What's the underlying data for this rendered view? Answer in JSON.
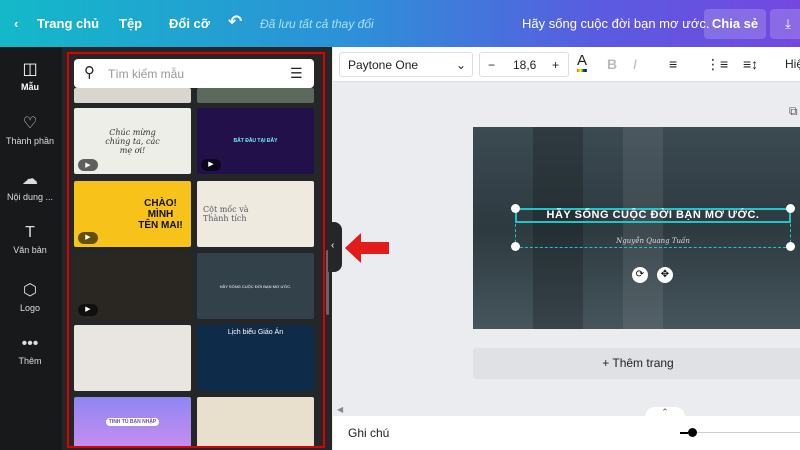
{
  "topbar": {
    "back": "Trang chủ",
    "file": "Tệp",
    "resize": "Đổi cỡ",
    "undo_icon": "undo-icon",
    "saved": "Đã lưu tất cả thay đổi",
    "doc_title": "Hãy sống cuộc đời bạn mơ ước.",
    "share": "Chia sẻ",
    "download_icon": "download-icon"
  },
  "rail": [
    {
      "label": "Mẫu",
      "icon": "layout-icon"
    },
    {
      "label": "Thành phần",
      "icon": "elements-icon"
    },
    {
      "label": "Nội dung ...",
      "icon": "upload-icon"
    },
    {
      "label": "Văn bản",
      "icon": "text-icon"
    },
    {
      "label": "Logo",
      "icon": "logo-icon"
    },
    {
      "label": "Thêm",
      "icon": "more-icon"
    }
  ],
  "panel": {
    "search_placeholder": "Tìm kiếm mẫu",
    "templates": [
      {
        "text": "Chúc mừng chúng ta, các mẹ ơi!"
      },
      {
        "text": "BẮT ĐẦU TẠI ĐÂY"
      },
      {
        "text": "CHÀO! MÌNH TÊN MAI!"
      },
      {
        "text": "Cột mốc và Thành tích"
      },
      {
        "text": ""
      },
      {
        "text": "HÃY SỐNG CUỘC ĐỜI BẠN MƠ ƯỚC."
      },
      {
        "text": ""
      },
      {
        "text": "Lịch biểu Giáo Án"
      },
      {
        "text": "TINH TÚ BẠN NHẬP"
      },
      {
        "text": ""
      }
    ]
  },
  "toolbar": {
    "font": "Paytone One",
    "size": "18,6",
    "minus": "−",
    "plus": "+",
    "bold": "B",
    "italic": "I",
    "more": "Hiệ"
  },
  "canvas": {
    "heading": "HÃY SỐNG CUỘC ĐỜI BẠN MƠ ƯỚC.",
    "author": "Nguyễn Quang Tuấn",
    "add_page": "+ Thêm trang"
  },
  "bottom": {
    "notes": "Ghi chú"
  },
  "colors": {
    "highlight": "#d00000",
    "selection": "#20c4cb"
  }
}
